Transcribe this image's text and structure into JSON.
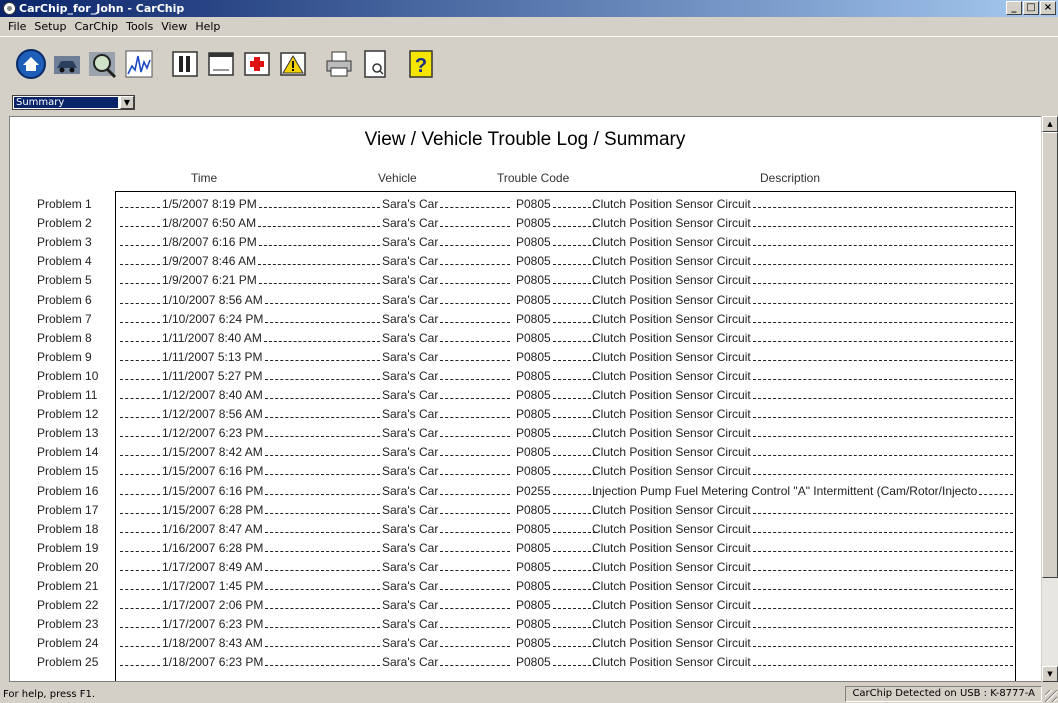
{
  "window": {
    "title": "CarChip_for_John - CarChip",
    "min": "_",
    "max": "□",
    "close": "×"
  },
  "menu": [
    "File",
    "Setup",
    "CarChip",
    "Tools",
    "View",
    "Help"
  ],
  "toolbar": [
    "home-icon",
    "vehicle-icon",
    "magnify-icon",
    "graph-icon",
    "report-icon",
    "window-icon",
    "medical-icon",
    "warning-icon",
    "print-icon",
    "preview-icon",
    "help-icon"
  ],
  "view_select": {
    "value": "Summary"
  },
  "report": {
    "title": "View / Vehicle Trouble Log / Summary",
    "columns": {
      "time": "Time",
      "vehicle": "Vehicle",
      "code": "Trouble Code",
      "description": "Description"
    },
    "rows": [
      {
        "label": "Problem 1",
        "time": "1/5/2007 8:19 PM",
        "vehicle": "Sara's Car",
        "code": "P0805",
        "desc": "Clutch Position Sensor Circuit"
      },
      {
        "label": "Problem 2",
        "time": "1/8/2007 6:50 AM",
        "vehicle": "Sara's Car",
        "code": "P0805",
        "desc": "Clutch Position Sensor Circuit"
      },
      {
        "label": "Problem 3",
        "time": "1/8/2007 6:16 PM",
        "vehicle": "Sara's Car",
        "code": "P0805",
        "desc": "Clutch Position Sensor Circuit"
      },
      {
        "label": "Problem 4",
        "time": "1/9/2007 8:46 AM",
        "vehicle": "Sara's Car",
        "code": "P0805",
        "desc": "Clutch Position Sensor Circuit"
      },
      {
        "label": "Problem 5",
        "time": "1/9/2007 6:21 PM",
        "vehicle": "Sara's Car",
        "code": "P0805",
        "desc": "Clutch Position Sensor Circuit"
      },
      {
        "label": "Problem 6",
        "time": "1/10/2007 8:56 AM",
        "vehicle": "Sara's Car",
        "code": "P0805",
        "desc": "Clutch Position Sensor Circuit"
      },
      {
        "label": "Problem 7",
        "time": "1/10/2007 6:24 PM",
        "vehicle": "Sara's Car",
        "code": "P0805",
        "desc": "Clutch Position Sensor Circuit"
      },
      {
        "label": "Problem 8",
        "time": "1/11/2007 8:40 AM",
        "vehicle": "Sara's Car",
        "code": "P0805",
        "desc": "Clutch Position Sensor Circuit"
      },
      {
        "label": "Problem 9",
        "time": "1/11/2007 5:13 PM",
        "vehicle": "Sara's Car",
        "code": "P0805",
        "desc": "Clutch Position Sensor Circuit"
      },
      {
        "label": "Problem 10",
        "time": "1/11/2007 5:27 PM",
        "vehicle": "Sara's Car",
        "code": "P0805",
        "desc": "Clutch Position Sensor Circuit"
      },
      {
        "label": "Problem 11",
        "time": "1/12/2007 8:40 AM",
        "vehicle": "Sara's Car",
        "code": "P0805",
        "desc": "Clutch Position Sensor Circuit"
      },
      {
        "label": "Problem 12",
        "time": "1/12/2007 8:56 AM",
        "vehicle": "Sara's Car",
        "code": "P0805",
        "desc": "Clutch Position Sensor Circuit"
      },
      {
        "label": "Problem 13",
        "time": "1/12/2007 6:23 PM",
        "vehicle": "Sara's Car",
        "code": "P0805",
        "desc": "Clutch Position Sensor Circuit"
      },
      {
        "label": "Problem 14",
        "time": "1/15/2007 8:42 AM",
        "vehicle": "Sara's Car",
        "code": "P0805",
        "desc": "Clutch Position Sensor Circuit"
      },
      {
        "label": "Problem 15",
        "time": "1/15/2007 6:16 PM",
        "vehicle": "Sara's Car",
        "code": "P0805",
        "desc": "Clutch Position Sensor Circuit"
      },
      {
        "label": "Problem 16",
        "time": "1/15/2007 6:16 PM",
        "vehicle": "Sara's Car",
        "code": "P0255",
        "desc": "Injection Pump Fuel Metering Control \"A\" Intermittent (Cam/Rotor/Injecto"
      },
      {
        "label": "Problem 17",
        "time": "1/15/2007 6:28 PM",
        "vehicle": "Sara's Car",
        "code": "P0805",
        "desc": "Clutch Position Sensor Circuit"
      },
      {
        "label": "Problem 18",
        "time": "1/16/2007 8:47 AM",
        "vehicle": "Sara's Car",
        "code": "P0805",
        "desc": "Clutch Position Sensor Circuit"
      },
      {
        "label": "Problem 19",
        "time": "1/16/2007 6:28 PM",
        "vehicle": "Sara's Car",
        "code": "P0805",
        "desc": "Clutch Position Sensor Circuit"
      },
      {
        "label": "Problem 20",
        "time": "1/17/2007 8:49 AM",
        "vehicle": "Sara's Car",
        "code": "P0805",
        "desc": "Clutch Position Sensor Circuit"
      },
      {
        "label": "Problem 21",
        "time": "1/17/2007 1:45 PM",
        "vehicle": "Sara's Car",
        "code": "P0805",
        "desc": "Clutch Position Sensor Circuit"
      },
      {
        "label": "Problem 22",
        "time": "1/17/2007 2:06 PM",
        "vehicle": "Sara's Car",
        "code": "P0805",
        "desc": "Clutch Position Sensor Circuit"
      },
      {
        "label": "Problem 23",
        "time": "1/17/2007 6:23 PM",
        "vehicle": "Sara's Car",
        "code": "P0805",
        "desc": "Clutch Position Sensor Circuit"
      },
      {
        "label": "Problem 24",
        "time": "1/18/2007 8:43 AM",
        "vehicle": "Sara's Car",
        "code": "P0805",
        "desc": "Clutch Position Sensor Circuit"
      },
      {
        "label": "Problem 25",
        "time": "1/18/2007 6:23 PM",
        "vehicle": "Sara's Car",
        "code": "P0805",
        "desc": "Clutch Position Sensor Circuit"
      }
    ]
  },
  "status": {
    "help": "For help, press F1.",
    "device": "CarChip Detected on USB : K-8777-A"
  }
}
